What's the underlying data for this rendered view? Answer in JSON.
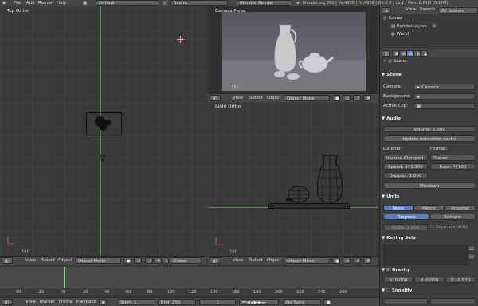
{
  "topbar": {
    "menus": [
      "File",
      "Add",
      "Render",
      "Help"
    ],
    "layout": "Default",
    "scene": "Scene",
    "engine": "Blender Render",
    "info": "blender.org 261 | Ve:4935 | Fa:4916 | Ob:0-8 | La:1 | Mem:6.81M (0.17M)"
  },
  "viewport_top": {
    "title": "Top Ortho",
    "corner_label": "(1)",
    "header": {
      "view": "View",
      "select": "Select",
      "object": "Object",
      "mode": "Object Mode",
      "orientation": "Global"
    }
  },
  "viewport_camera": {
    "title": "Camera Persp",
    "corner_label": "(1)",
    "header": {
      "view": "View",
      "select": "Select",
      "object": "Object",
      "mode": "Object Mode"
    }
  },
  "viewport_right": {
    "title": "Right Ortho",
    "corner_label": "(1)",
    "header": {
      "view": "View",
      "select": "Select",
      "object": "Object",
      "mode": "Object Mode"
    }
  },
  "outliner": {
    "header": {
      "view": "View",
      "search": "Search",
      "filter": "All Scenes"
    },
    "items": [
      "Scene",
      "RenderLayers",
      "World"
    ]
  },
  "properties": {
    "breadcrumb": "Scene",
    "scene_section": {
      "title": "Scene",
      "camera_label": "Camera:",
      "camera_value": "Camera",
      "background_label": "Background:",
      "active_clip_label": "Active Clip:"
    },
    "audio_section": {
      "title": "Audio",
      "volume": "Volume: 1.000",
      "update_button": "Update animation cache",
      "listener_label": "Listener:",
      "listener_value": "Inverse Clamped",
      "format_label": "Format:",
      "format_value": "Stereo",
      "speed": "Speed: 343.300",
      "rate": "Rate: 44100",
      "doppler": "Doppler: 1.000",
      "mixdown_button": "Mixdown"
    },
    "units_section": {
      "title": "Units",
      "unit_options": [
        "None",
        "Metric",
        "Imperial"
      ],
      "unit_selected": "None",
      "rotation_options": [
        "Degrees",
        "Radians"
      ],
      "rotation_selected": "Degrees",
      "scale": "Scale: 1.000",
      "separate_units": "Separate Units"
    },
    "keying_sets_section": {
      "title": "Keying Sets"
    },
    "gravity_section": {
      "title": "Gravity",
      "x": "X: 0.000",
      "y": "Y: 0.000",
      "z": "Z: -9.810"
    },
    "simplify_section": {
      "title": "Simplify"
    }
  },
  "timeline": {
    "ticks": [
      "-40",
      "-20",
      "0",
      "20",
      "40",
      "60",
      "80",
      "100",
      "120",
      "140",
      "160",
      "180",
      "200",
      "220",
      "240",
      "260"
    ],
    "header": {
      "view": "View",
      "marker": "Marker",
      "frame": "Frame",
      "playback": "Playback",
      "start": "Start: 1",
      "end": "End: 250",
      "current": "1",
      "sync": "No Sync"
    }
  },
  "colors": {
    "accent_blue": "#5680c2",
    "grid_green": "#3f9a3f",
    "grid_red": "#9a3f3f",
    "frame_marker": "#6ee06e"
  }
}
